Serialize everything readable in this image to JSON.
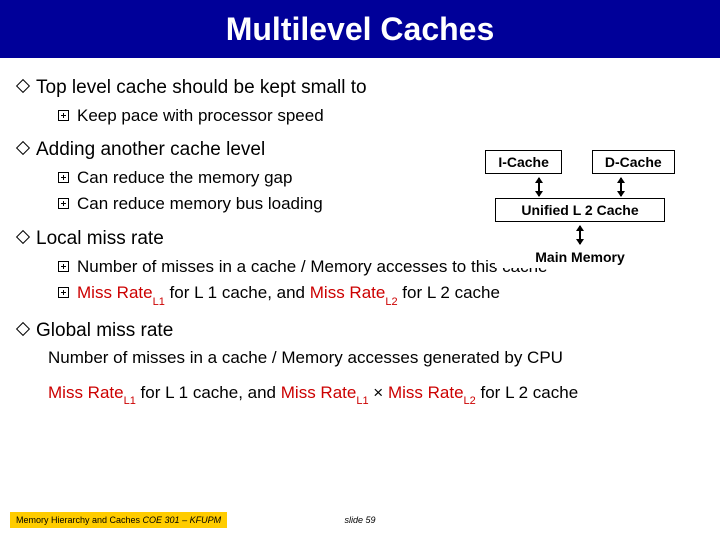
{
  "title": "Multilevel Caches",
  "b1": {
    "text": "Top level cache should be kept small to",
    "sub1": "Keep pace with processor speed"
  },
  "b2": {
    "text": "Adding another cache level",
    "sub1": "Can reduce the memory gap",
    "sub2": "Can reduce memory bus loading"
  },
  "b3": {
    "text": "Local miss rate",
    "sub1": "Number of misses in a cache / Memory accesses to this cache",
    "sub2_a": "Miss Rate",
    "sub2_l1sub": "L1",
    "sub2_b": " for L 1 cache, and ",
    "sub2_c": "Miss Rate",
    "sub2_l2sub": "L2",
    "sub2_d": " for L 2 cache"
  },
  "b4": {
    "text": "Global miss rate",
    "line1": "Number of misses in a cache / Memory accesses generated by CPU",
    "l2_a": "Miss Rate",
    "l2_l1sub": "L1",
    "l2_b": " for L 1 cache, and ",
    "l2_c": "Miss Rate",
    "l2_l1sub2": "L1",
    "l2_mid": " × ",
    "l2_d": "Miss Rate",
    "l2_l2sub": "L2",
    "l2_e": " for L 2 cache"
  },
  "diagram": {
    "icache": "I-Cache",
    "dcache": "D-Cache",
    "l2": "Unified L 2 Cache",
    "mem": "Main Memory"
  },
  "footer": {
    "left_plain": "Memory Hierarchy and Caches",
    "left_italic": "  COE 301 – KFUPM",
    "center": "slide 59"
  }
}
